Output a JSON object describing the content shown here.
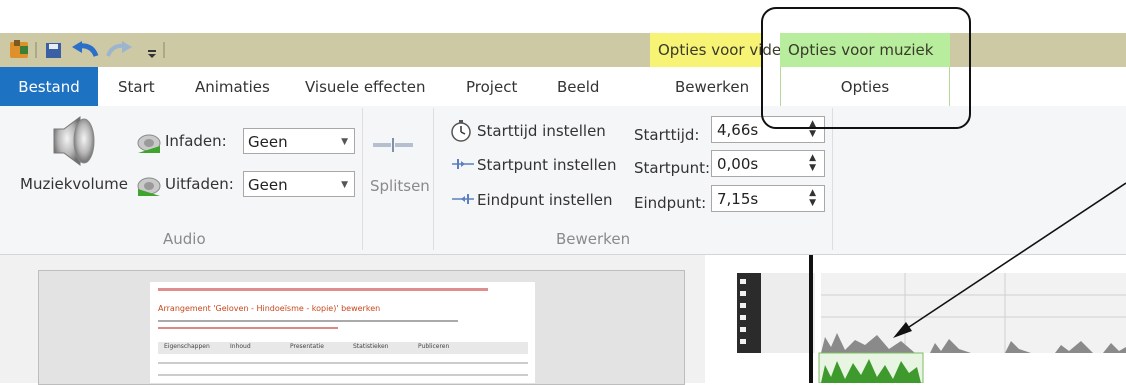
{
  "contextual": {
    "video_label": "Opties voor video",
    "music_label": "Opties voor muziek"
  },
  "tabs": {
    "bestand": "Bestand",
    "start": "Start",
    "animaties": "Animaties",
    "visuele_effecten": "Visuele effecten",
    "project": "Project",
    "beeld": "Beeld",
    "bewerken": "Bewerken",
    "opties": "Opties"
  },
  "audio": {
    "volume_label": "Muziekvolume",
    "fade_in_label": "Infaden:",
    "fade_in_value": "Geen",
    "fade_out_label": "Uitfaden:",
    "fade_out_value": "Geen",
    "group_label": "Audio"
  },
  "split": {
    "label": "Splitsen"
  },
  "edit": {
    "set_start_time": "Starttijd instellen",
    "set_start_point": "Startpunt instellen",
    "set_end_point": "Eindpunt instellen",
    "start_time_label": "Starttijd:",
    "start_time_value": "4,66s",
    "start_point_label": "Startpunt:",
    "start_point_value": "0,00s",
    "end_point_label": "Eindpunt:",
    "end_point_value": "7,15s",
    "group_label": "Bewerken"
  },
  "preview": {
    "title": "Arrangement 'Geloven - Hindoeïsme - kopie)' bewerken",
    "tabs": [
      "Eigenschappen",
      "Inhoud",
      "Presentatie",
      "Statistieken",
      "Publiceren"
    ]
  },
  "colors": {
    "bestand_tab": "#1e72c2",
    "qat_bg": "#ccc9a4",
    "video_ctx": "#f7f374",
    "music_ctx": "#b7ed9c",
    "waveform": "#3f9a2e"
  }
}
